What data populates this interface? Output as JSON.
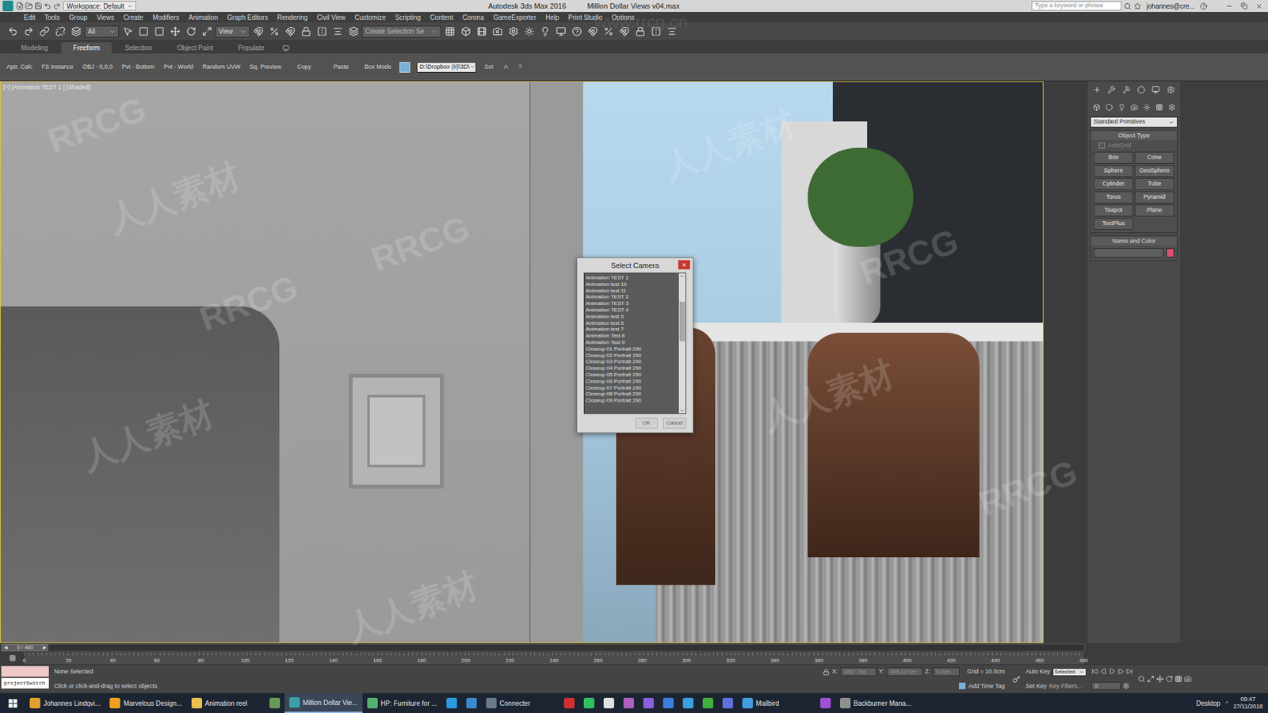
{
  "window": {
    "title": "Autodesk 3ds Max 2016",
    "file": "Million Dollar Views v04.max",
    "workspace": "Workspace: Default",
    "search_placeholder": "Type a keyword or phrase",
    "user": "johannes@cre..."
  },
  "menu": [
    "Edit",
    "Tools",
    "Group",
    "Views",
    "Create",
    "Modifiers",
    "Animation",
    "Graph Editors",
    "Rendering",
    "Civil View",
    "Customize",
    "Scripting",
    "Content",
    "Corona",
    "GameExporter",
    "Help",
    "Print Studio",
    "Options"
  ],
  "toolbar": {
    "selection_filter": "All",
    "reference_coord": "View",
    "named_selection": "Create Selection Se"
  },
  "ribbon": {
    "tabs": [
      {
        "label": "Modeling",
        "selected": false
      },
      {
        "label": "Freeform",
        "selected": true
      },
      {
        "label": "Selection",
        "selected": false
      },
      {
        "label": "Object Paint",
        "selected": false
      },
      {
        "label": "Populate",
        "selected": false
      }
    ],
    "tools": [
      "Aptr. Calc",
      "FS Instance",
      "OBJ - 0,0,0",
      "Pvt - Bottom",
      "Pvt - World",
      "Random UVW",
      "Sq. Preview",
      "Copy",
      "Paste",
      "Box Mode"
    ],
    "path": "D:\\Dropbox (II)\\3D\\",
    "extra": [
      "Set",
      "A",
      "?"
    ]
  },
  "viewport": {
    "label": "[+] [Animation TEST 1 ] [Shaded]",
    "active": true
  },
  "dialog": {
    "title": "Select Camera",
    "close": "×",
    "scroll_level": 0.3,
    "cameras": [
      {
        "name": "Animation TEST 1",
        "selected": false
      },
      {
        "name": "Animation test 10",
        "selected": false
      },
      {
        "name": "Animation test 11",
        "selected": false
      },
      {
        "name": "Animation TEST 2",
        "selected": false
      },
      {
        "name": "Animation TEST 3",
        "selected": false
      },
      {
        "name": "Animation TEST 4",
        "selected": false
      },
      {
        "name": "Animation test 5",
        "selected": false
      },
      {
        "name": "Animation test 6",
        "selected": false
      },
      {
        "name": "Animation test 7",
        "selected": false
      },
      {
        "name": "Animation Test 8",
        "selected": false
      },
      {
        "name": "Animation Test 9",
        "selected": false
      },
      {
        "name": "Closeup 01 Portrait 290",
        "selected": false
      },
      {
        "name": "Closeup 02 Portrait 290",
        "selected": false
      },
      {
        "name": "Closeup 03 Portrait 290",
        "selected": false
      },
      {
        "name": "Closeup 04 Portrait 290",
        "selected": false
      },
      {
        "name": "Closeup 05 Portrait 290",
        "selected": false
      },
      {
        "name": "Closeup 06 Portrait 290",
        "selected": false
      },
      {
        "name": "Closeup 07 Portrait 290",
        "selected": false
      },
      {
        "name": "Closeup 08 Portrait 290",
        "selected": false
      },
      {
        "name": "Closeup 09 Portrait 290",
        "selected": false
      }
    ],
    "buttons": [
      "OK",
      "Cancel"
    ]
  },
  "command_panel": {
    "category": "Standard Primitives",
    "object_type_title": "Object Type",
    "autogrid": {
      "label": "AutoGrid",
      "checked": false
    },
    "buttons": [
      "Box",
      "Cone",
      "Sphere",
      "GeoSphere",
      "Cylinder",
      "Tube",
      "Torus",
      "Pyramid",
      "Teapot",
      "Plane",
      "TextPlus"
    ],
    "name_and_color_title": "Name and Color",
    "name": "",
    "color": "#d9506a"
  },
  "timeline": {
    "position": "0 / 480",
    "level": 0,
    "ticks": [
      "0",
      "20",
      "40",
      "60",
      "80",
      "100",
      "120",
      "140",
      "160",
      "180",
      "200",
      "220",
      "240",
      "260",
      "280",
      "300",
      "320",
      "340",
      "360",
      "380",
      "400",
      "420",
      "440",
      "460",
      "480"
    ]
  },
  "status": {
    "script_listener": "projectSwitch",
    "selection": "None Selected",
    "prompt": "Click or click-and-drag to select objects",
    "x": "1067.798",
    "y": "458.137cm",
    "z": "0.0cm",
    "grid": "Grid = 10.0cm",
    "add_time_tag": "Add Time Tag",
    "auto_key": "Auto Key",
    "key_mode": "Selected",
    "set_key": "Set Key",
    "key_filters": "Key Filters...",
    "frame": "0"
  },
  "taskbar": {
    "items": [
      {
        "kind": "labeled",
        "label": "Johannes Lindqvi...",
        "selected": false,
        "color": "#e0a030"
      },
      {
        "kind": "labeled",
        "label": "Marvelous Design...",
        "selected": false,
        "color": "#f0a020"
      },
      {
        "kind": "labeled",
        "label": "Animation reel",
        "selected": false,
        "color": "#e8c050"
      },
      {
        "kind": "icon",
        "label": "",
        "selected": false,
        "color": "#6a9a5a"
      },
      {
        "kind": "labeled",
        "label": "Million Dollar Vie...",
        "selected": true,
        "color": "#3aa0a8"
      },
      {
        "kind": "labeled",
        "label": "HP: Furniture for ...",
        "selected": false,
        "color": "#58b070"
      },
      {
        "kind": "icon",
        "label": "",
        "selected": false,
        "color": "#2a9ae0"
      },
      {
        "kind": "icon",
        "label": "",
        "selected": false,
        "color": "#3a8ad0"
      },
      {
        "kind": "labeled",
        "label": "Connecter",
        "selected": false,
        "color": "#6a7a8a"
      },
      {
        "kind": "icon",
        "label": "",
        "selected": false,
        "color": "#d03030"
      },
      {
        "kind": "icon",
        "label": "",
        "selected": false,
        "color": "#30c060"
      },
      {
        "kind": "icon",
        "label": "",
        "selected": false,
        "color": "#e0e0e0"
      },
      {
        "kind": "icon",
        "label": "",
        "selected": false,
        "color": "#b060c0"
      },
      {
        "kind": "icon",
        "label": "",
        "selected": false,
        "color": "#8a60e0"
      },
      {
        "kind": "icon",
        "label": "",
        "selected": false,
        "color": "#3a80e0"
      },
      {
        "kind": "icon",
        "label": "",
        "selected": false,
        "color": "#3aa0e0"
      },
      {
        "kind": "icon",
        "label": "",
        "selected": false,
        "color": "#40b040"
      },
      {
        "kind": "icon",
        "label": "",
        "selected": false,
        "color": "#6070e0"
      },
      {
        "kind": "labeled",
        "label": "Mailbird",
        "selected": false,
        "color": "#40a0e0"
      },
      {
        "kind": "icon",
        "label": "",
        "selected": false,
        "color": "#a050d0"
      },
      {
        "kind": "labeled",
        "label": "Backburner Mana...",
        "selected": false,
        "color": "#909090"
      }
    ],
    "desktop": "Desktop",
    "time": "09:47",
    "date": "27/11/2018"
  },
  "watermarks": {
    "site": "www.rrcg.cn",
    "marks": [
      "RRCG",
      "人人素材",
      "RRCG",
      "人人素材",
      "RRCG",
      "人人素材",
      "RRCG",
      "人人素材",
      "RRCG",
      "人人素材"
    ]
  }
}
